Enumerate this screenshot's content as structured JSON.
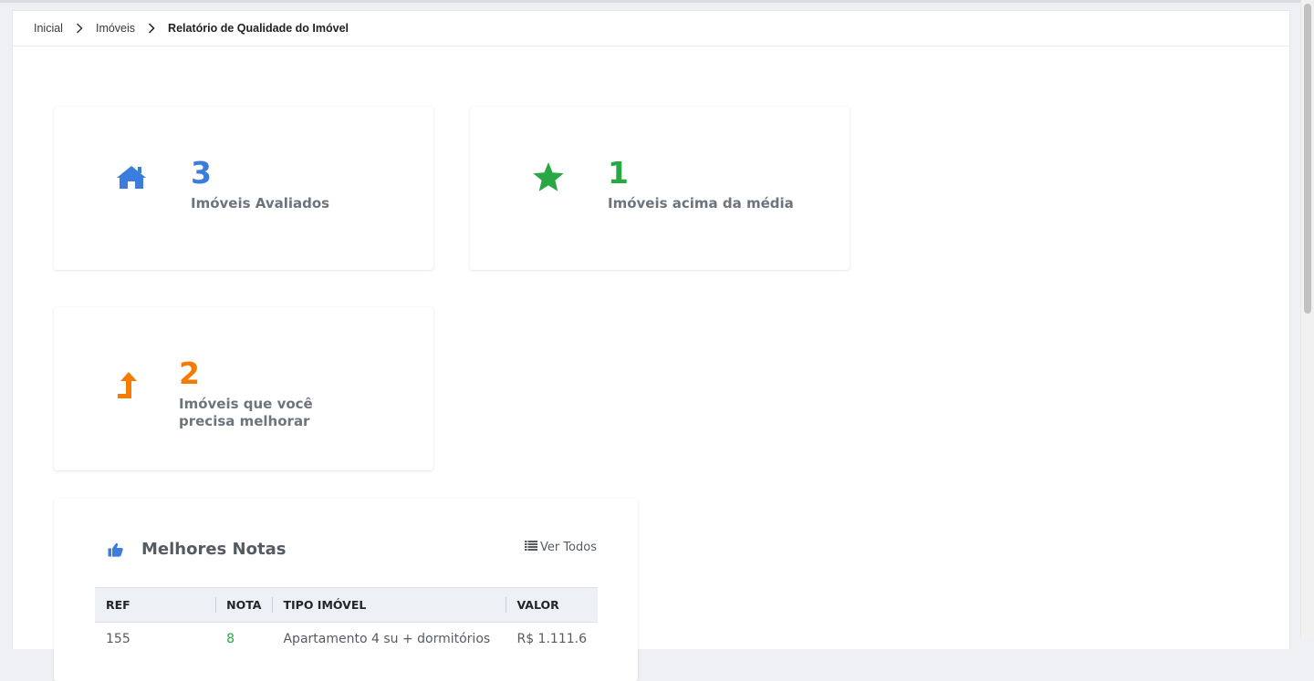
{
  "breadcrumb": {
    "items": [
      "Inicial",
      "Imóveis"
    ],
    "current": "Relatório de Qualidade do Imóvel"
  },
  "stats": [
    {
      "value": "3",
      "label": "Imóveis Avaliados",
      "icon": "home-icon",
      "color": "#3b7ddd"
    },
    {
      "value": "1",
      "label": "Imóveis acima da média",
      "icon": "star-icon",
      "color": "#28a745"
    },
    {
      "value": "2",
      "label": "Imóveis que você precisa melhorar",
      "icon": "level-up-arrow-icon",
      "color": "#f57c00"
    }
  ],
  "best": {
    "title": "Melhores Notas",
    "icon": "thumbs-up-icon",
    "see_all_icon": "list-icon",
    "see_all": "Ver Todos",
    "columns": [
      "REF",
      "NOTA",
      "TIPO IMÓVEL",
      "VALOR"
    ],
    "rows": [
      [
        "155",
        "8",
        "Apartamento 4 su + dormitórios",
        "R$ 1.111.6"
      ]
    ]
  }
}
